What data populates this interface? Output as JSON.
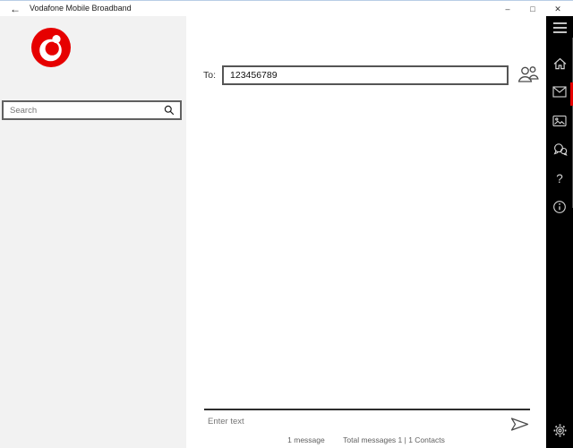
{
  "titlebar": {
    "back_glyph": "←",
    "title": "Vodafone Mobile Broadband",
    "minimize_glyph": "–",
    "maximize_glyph": "□",
    "close_glyph": "✕"
  },
  "sidebar": {
    "search_placeholder": "Search"
  },
  "main": {
    "to_label": "To:",
    "to_value": "123456789",
    "message_placeholder": "Enter text",
    "status_left": "1 message",
    "status_right": "Total messages  1 | 1 Contacts"
  },
  "nav": {
    "help_glyph": "?",
    "selected_item": "messages",
    "items": [
      {
        "id": "menu",
        "icon": "hamburger-icon"
      },
      {
        "id": "home",
        "icon": "home-icon"
      },
      {
        "id": "messages",
        "icon": "envelope-icon",
        "selected": true
      },
      {
        "id": "media",
        "icon": "picture-icon"
      },
      {
        "id": "chat",
        "icon": "chat-bubbles-icon"
      },
      {
        "id": "help",
        "icon": "question-mark-icon"
      },
      {
        "id": "info",
        "icon": "info-icon"
      },
      {
        "id": "settings",
        "icon": "gear-icon"
      }
    ]
  },
  "colors": {
    "vodafone_red": "#e60000",
    "nav_background": "#000000",
    "sidebar_background": "#f2f2f2"
  }
}
